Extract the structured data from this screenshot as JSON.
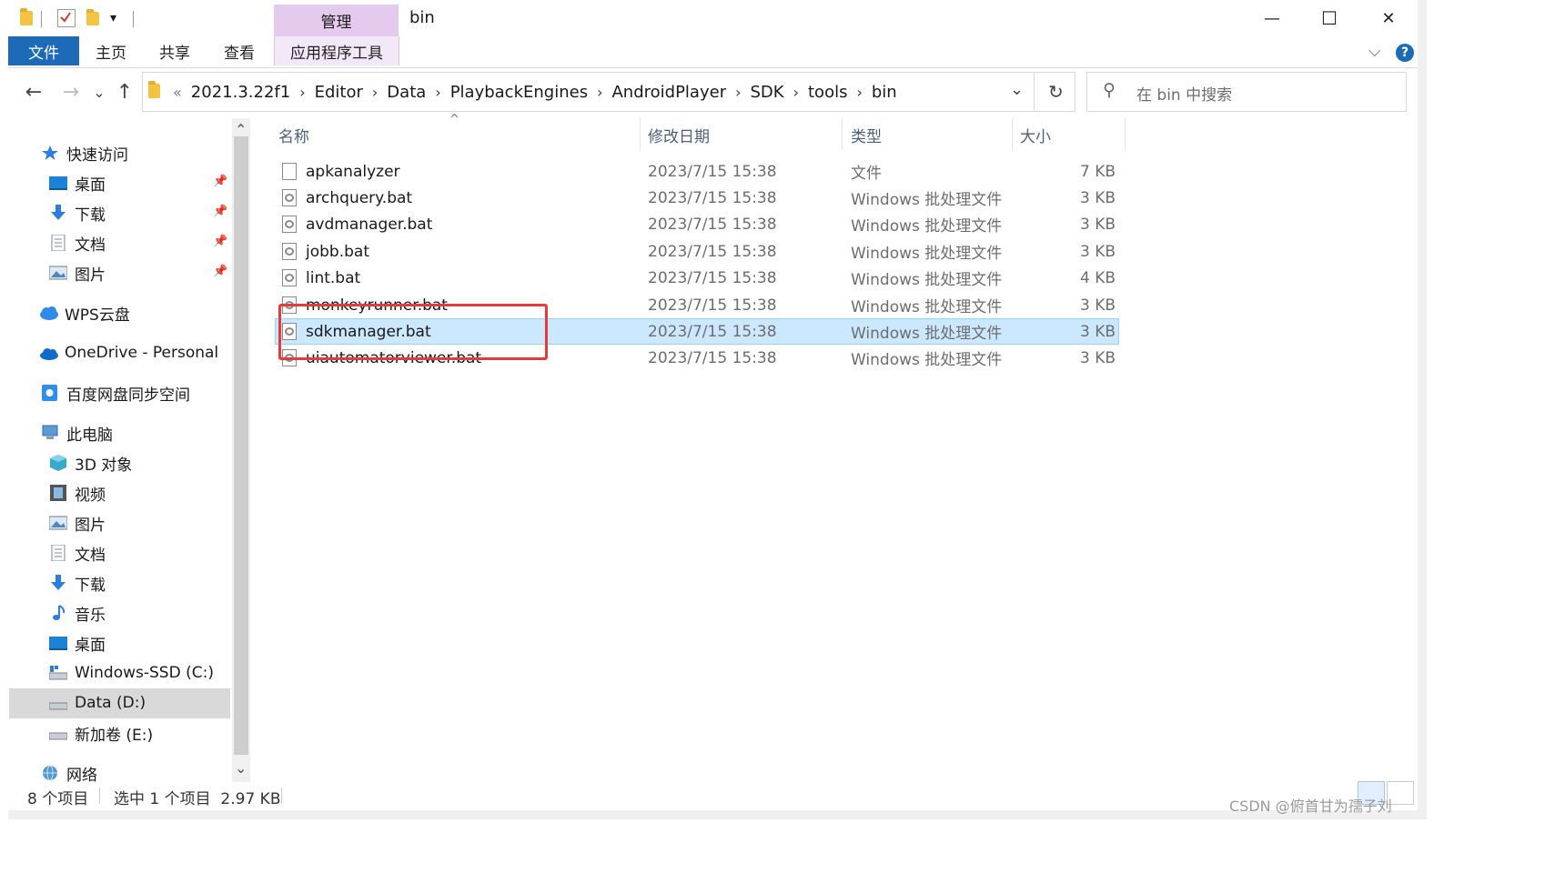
{
  "window": {
    "title": "bin",
    "manage_tab": "管理",
    "minimize_glyph": "—",
    "maximize_glyph": "☐",
    "close_glyph": "✕",
    "help_glyph": "?"
  },
  "ribbon": {
    "tabs": [
      "文件",
      "主页",
      "共享",
      "查看",
      "应用程序工具"
    ],
    "collapse_glyph": "⌵"
  },
  "address": {
    "back_glyph": "←",
    "forward_glyph": "→",
    "recent_glyph": "⌄",
    "up_glyph": "↑",
    "overflow_glyph": "«",
    "breadcrumbs": [
      "2021.3.22f1",
      "Editor",
      "Data",
      "PlaybackEngines",
      "AndroidPlayer",
      "SDK",
      "tools",
      "bin"
    ],
    "crumb_sep": "›",
    "dropdown_glyph": "⌄",
    "refresh_glyph": "↻",
    "search_placeholder": "在 bin 中搜索",
    "search_glyph": "⚲"
  },
  "nav": {
    "quick_access": "快速访问",
    "quick_items": [
      {
        "label": "桌面",
        "icon": "desktop-icon"
      },
      {
        "label": "下载",
        "icon": "download-icon"
      },
      {
        "label": "文档",
        "icon": "document-icon"
      },
      {
        "label": "图片",
        "icon": "picture-icon"
      }
    ],
    "pin_glyph": "📌",
    "wps": "WPS云盘",
    "onedrive": "OneDrive - Personal",
    "baidu": "百度网盘同步空间",
    "this_pc": "此电脑",
    "pc_items": [
      {
        "label": "3D 对象",
        "icon": "3d-objects-icon"
      },
      {
        "label": "视频",
        "icon": "video-icon"
      },
      {
        "label": "图片",
        "icon": "picture-icon"
      },
      {
        "label": "文档",
        "icon": "document-icon"
      },
      {
        "label": "下载",
        "icon": "download-icon"
      },
      {
        "label": "音乐",
        "icon": "music-icon"
      },
      {
        "label": "桌面",
        "icon": "desktop-icon"
      },
      {
        "label": "Windows-SSD (C:)",
        "icon": "drive-icon"
      },
      {
        "label": "Data (D:)",
        "icon": "drive-icon"
      },
      {
        "label": "新加卷 (E:)",
        "icon": "drive-icon"
      }
    ],
    "network": "网络",
    "scroll_up_glyph": "⌃",
    "scroll_down_glyph": "⌄"
  },
  "list": {
    "headers": {
      "name": "名称",
      "modified": "修改日期",
      "type": "类型",
      "size": "大小"
    },
    "sort_glyph": "^",
    "files": [
      {
        "name": "apkanalyzer",
        "modified": "2023/7/15 15:38",
        "type": "文件",
        "size": "7 KB",
        "icon": "file-icon"
      },
      {
        "name": "archquery.bat",
        "modified": "2023/7/15 15:38",
        "type": "Windows 批处理文件",
        "size": "3 KB",
        "icon": "batch-file-icon"
      },
      {
        "name": "avdmanager.bat",
        "modified": "2023/7/15 15:38",
        "type": "Windows 批处理文件",
        "size": "3 KB",
        "icon": "batch-file-icon"
      },
      {
        "name": "jobb.bat",
        "modified": "2023/7/15 15:38",
        "type": "Windows 批处理文件",
        "size": "3 KB",
        "icon": "batch-file-icon"
      },
      {
        "name": "lint.bat",
        "modified": "2023/7/15 15:38",
        "type": "Windows 批处理文件",
        "size": "4 KB",
        "icon": "batch-file-icon"
      },
      {
        "name": "monkeyrunner.bat",
        "modified": "2023/7/15 15:38",
        "type": "Windows 批处理文件",
        "size": "3 KB",
        "icon": "batch-file-icon"
      },
      {
        "name": "sdkmanager.bat",
        "modified": "2023/7/15 15:38",
        "type": "Windows 批处理文件",
        "size": "3 KB",
        "icon": "batch-file-icon",
        "selected": true
      },
      {
        "name": "uiautomatorviewer.bat",
        "modified": "2023/7/15 15:38",
        "type": "Windows 批处理文件",
        "size": "3 KB",
        "icon": "batch-file-icon"
      }
    ]
  },
  "status": {
    "count": "8 个项目",
    "selection": "选中 1 个项目  2.97 KB"
  },
  "watermark": "CSDN @俯首甘为孺子刘",
  "colors": {
    "accent": "#1d6ab8",
    "selection": "#cce8ff",
    "manage_tab": "#e4cbee",
    "highlight_box": "#e53b3b"
  }
}
